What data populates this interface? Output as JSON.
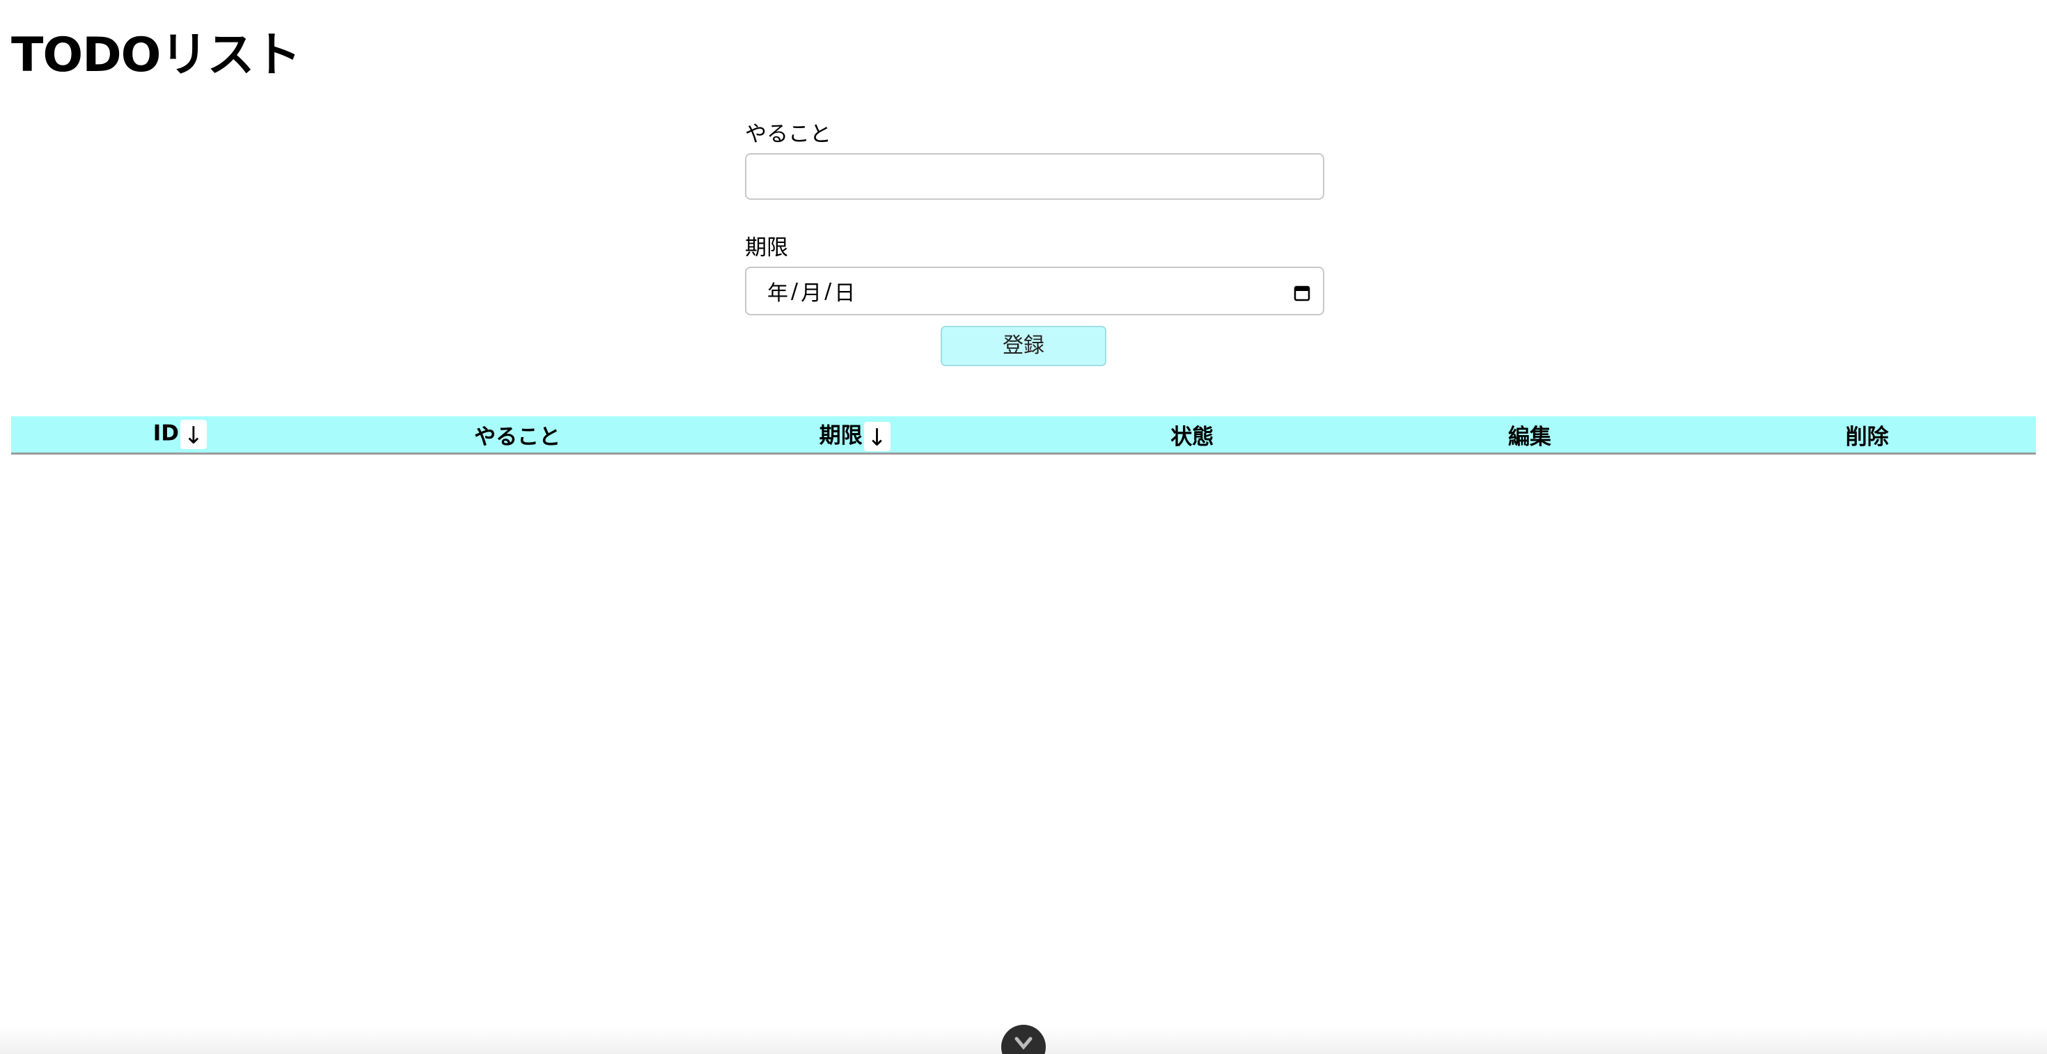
{
  "page": {
    "title": "TODOリスト"
  },
  "form": {
    "todo_label": "やること",
    "todo_value": "",
    "deadline_label": "期限",
    "date_year": "年",
    "date_sep": "/",
    "date_month": "月",
    "date_day": "日",
    "submit_label": "登録"
  },
  "table": {
    "headers": [
      {
        "label": "ID",
        "sortable": true
      },
      {
        "label": "やること",
        "sortable": false
      },
      {
        "label": "期限",
        "sortable": true
      },
      {
        "label": "状態",
        "sortable": false
      },
      {
        "label": "編集",
        "sortable": false
      },
      {
        "label": "削除",
        "sortable": false
      }
    ],
    "sort_arrow": "↓",
    "rows": []
  },
  "icons": {
    "calendar": "calendar-icon",
    "toolbar_toggle": "chevron-down-icon"
  },
  "colors": {
    "header_bg": "#a8fdfc",
    "button_bg": "#c2fbfd"
  }
}
